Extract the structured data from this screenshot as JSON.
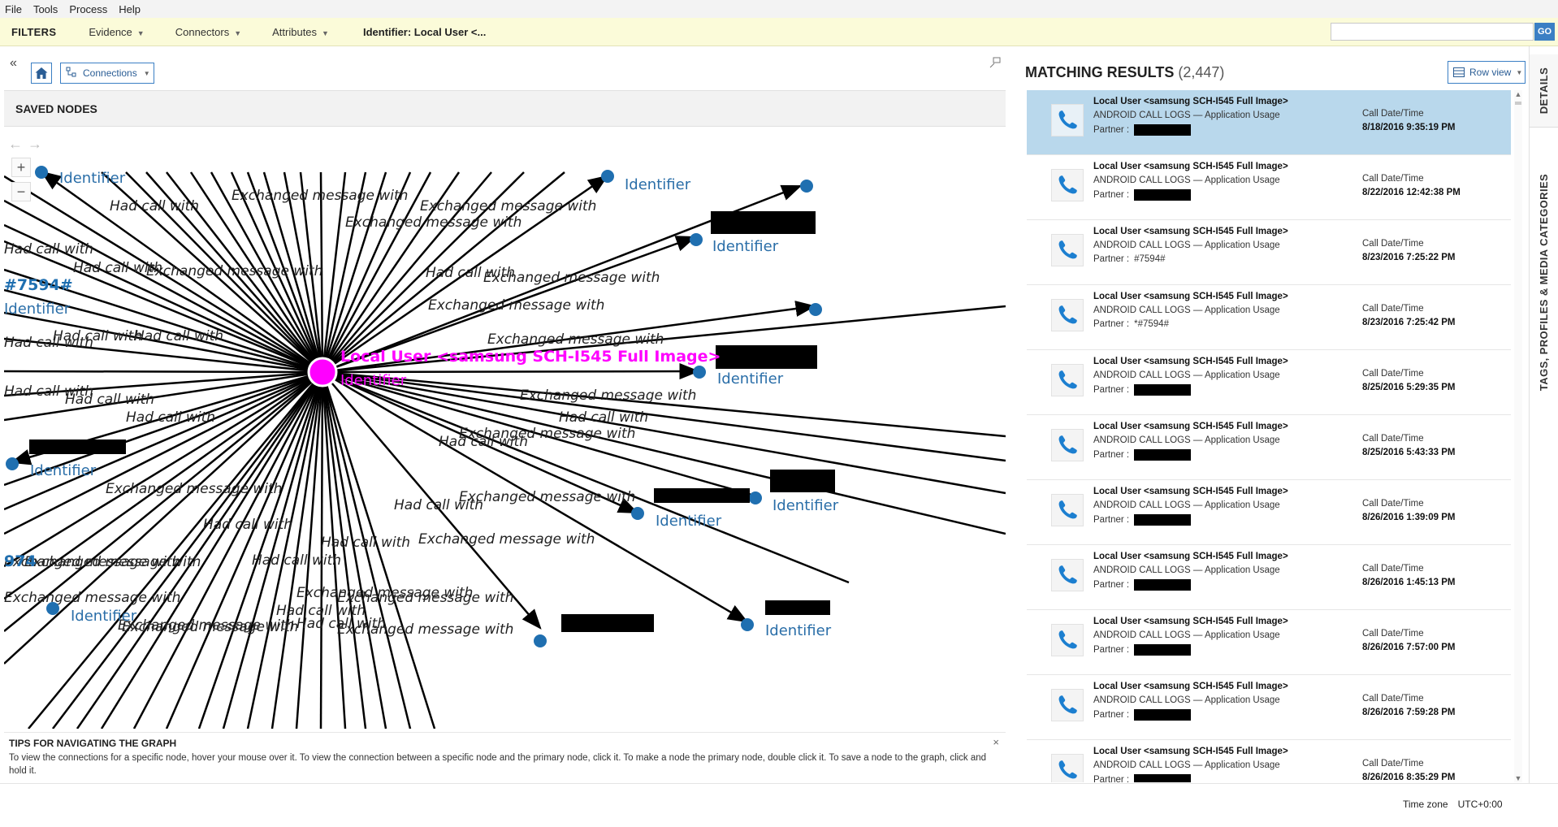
{
  "menu": {
    "items": [
      "File",
      "Tools",
      "Process",
      "Help"
    ]
  },
  "filters": {
    "title": "FILTERS",
    "evidence": "Evidence",
    "connectors": "Connectors",
    "attributes": "Attributes",
    "identifier": "Identifier: Local User <...",
    "search_value": "",
    "go_label": "GO"
  },
  "toolbar": {
    "connections_label": "Connections"
  },
  "saved_nodes": {
    "title": "SAVED NODES"
  },
  "graph": {
    "center_label": "Local User <samsung SCH-I545 Full Image>",
    "center_sublabel": "Identifier",
    "node_label": "Identifier",
    "partial_number": "#7594#",
    "partial_number_left": "974",
    "edge_labels": [
      "Had call with",
      "Exchanged message with"
    ]
  },
  "tips": {
    "title": "TIPS FOR NAVIGATING THE GRAPH",
    "body": "To view the connections for a specific node, hover your mouse over it. To view the connection between a specific node and the primary node, click it. To make a node the primary node, double click it. To save a node to the graph, click and hold it.",
    "close_glyph": "×"
  },
  "results": {
    "title": "MATCHING RESULTS",
    "count": "(2,447)",
    "row_view_label": "Row view",
    "date_label": "Call Date/Time",
    "partner_label": "Partner :",
    "rows": [
      {
        "title": "Local User <samsung SCH-I545 Full Image>",
        "source": "ANDROID CALL LOGS  —  Application Usage",
        "partner": "",
        "date": "8/18/2016 9:35:19 PM",
        "selected": true
      },
      {
        "title": "Local User <samsung SCH-I545 Full Image>",
        "source": "ANDROID CALL LOGS  —  Application Usage",
        "partner": "",
        "date": "8/22/2016 12:42:38 PM",
        "selected": false
      },
      {
        "title": "Local User <samsung SCH-I545 Full Image>",
        "source": "ANDROID CALL LOGS  —  Application Usage",
        "partner": "#7594#",
        "date": "8/23/2016 7:25:22 PM",
        "selected": false
      },
      {
        "title": "Local User <samsung SCH-I545 Full Image>",
        "source": "ANDROID CALL LOGS  —  Application Usage",
        "partner": "*#7594#",
        "date": "8/23/2016 7:25:42 PM",
        "selected": false
      },
      {
        "title": "Local User <samsung SCH-I545 Full Image>",
        "source": "ANDROID CALL LOGS  —  Application Usage",
        "partner": "",
        "date": "8/25/2016 5:29:35 PM",
        "selected": false
      },
      {
        "title": "Local User <samsung SCH-I545 Full Image>",
        "source": "ANDROID CALL LOGS  —  Application Usage",
        "partner": "",
        "date": "8/25/2016 5:43:33 PM",
        "selected": false
      },
      {
        "title": "Local User <samsung SCH-I545 Full Image>",
        "source": "ANDROID CALL LOGS  —  Application Usage",
        "partner": "",
        "date": "8/26/2016 1:39:09 PM",
        "selected": false
      },
      {
        "title": "Local User <samsung SCH-I545 Full Image>",
        "source": "ANDROID CALL LOGS  —  Application Usage",
        "partner": "",
        "date": "8/26/2016 1:45:13 PM",
        "selected": false
      },
      {
        "title": "Local User <samsung SCH-I545 Full Image>",
        "source": "ANDROID CALL LOGS  —  Application Usage",
        "partner": "",
        "date": "8/26/2016 7:57:00 PM",
        "selected": false
      },
      {
        "title": "Local User <samsung SCH-I545 Full Image>",
        "source": "ANDROID CALL LOGS  —  Application Usage",
        "partner": "",
        "date": "8/26/2016 7:59:28 PM",
        "selected": false
      },
      {
        "title": "Local User <samsung SCH-I545 Full Image>",
        "source": "ANDROID CALL LOGS  —  Application Usage",
        "partner": "",
        "date": "8/26/2016 8:35:29 PM",
        "selected": false
      }
    ]
  },
  "side_tabs": {
    "details": "DETAILS",
    "tags": "TAGS, PROFILES & MEDIA CATEGORIES"
  },
  "status": {
    "timezone_label": "Time zone",
    "timezone_value": "UTC+0:00"
  },
  "colors": {
    "accent": "#3b7fc4",
    "center_node": "#ff00ff",
    "node": "#1f6fb0",
    "filter_bg": "#fbfbd9",
    "selected_row": "#b9d8ec"
  }
}
